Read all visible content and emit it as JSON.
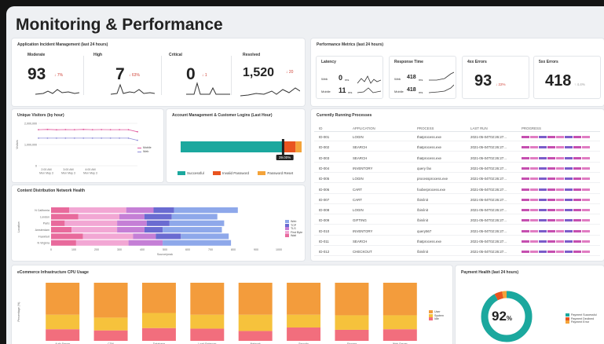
{
  "page_title": "Monitoring & Performance",
  "incident": {
    "title": "Application Incident Management (last 24 hours)",
    "tiles": [
      {
        "label": "Moderate",
        "value": "93",
        "delta": "↓ 7%"
      },
      {
        "label": "High",
        "value": "7",
        "delta": "↓ 63%"
      },
      {
        "label": "Critical",
        "value": "0",
        "delta": "↓ 1"
      },
      {
        "label": "Resolved",
        "value": "1,520",
        "delta": "↓ 20"
      }
    ]
  },
  "perf": {
    "title": "Performance Metrics (last 24 hours)",
    "latency": {
      "label": "Latency",
      "web_label": "Web",
      "web_value": "0",
      "web_unit": "ms",
      "mobile_label": "Mobile",
      "mobile_value": "11",
      "mobile_unit": "ms"
    },
    "response": {
      "label": "Response Time",
      "web_label": "Web",
      "web_value": "418",
      "web_unit": "ms",
      "mobile_label": "Mobile",
      "mobile_value": "418",
      "mobile_unit": "ms"
    },
    "errors4xx": {
      "label": "4xx Errors",
      "value": "93",
      "delta": "↓ 22%"
    },
    "errors5xx": {
      "label": "5xx Errors",
      "value": "418",
      "delta": "↑ 4.4%"
    }
  },
  "visitors": {
    "title": "Unique Visitors (by hour)",
    "ylabel": "Visitors",
    "yticks": [
      "2,000,000",
      "1,000,000",
      "0"
    ],
    "xticks": [
      "2:00 AM\nMon May 3",
      "3:00 AM\nMon May 3",
      "4:00 AM\nMon May 3"
    ],
    "legend": [
      "Mobile",
      "Web"
    ]
  },
  "logins": {
    "title": "Account Management & Customer Logins (Last Hour)",
    "marker": "39.00%",
    "legend": [
      "Successful",
      "Invalid Password",
      "Password Reset"
    ],
    "colors": [
      "#1ba89e",
      "#e9541f",
      "#f4a339"
    ]
  },
  "processes": {
    "title": "Currently Running Processes",
    "columns": [
      "ID",
      "APPLICATION",
      "PROCESS",
      "LAST RUN",
      "PROGRESS"
    ],
    "rows": [
      [
        "ID-001",
        "LOGIN",
        "thatprocess.exe",
        "2021-05-04T02:26:27..."
      ],
      [
        "ID-002",
        "SEARCH",
        "thatprocess.exe",
        "2021-05-04T02:26:27..."
      ],
      [
        "ID-003",
        "SEARCH",
        "thatprocess.exe",
        "2021-05-04T02:26:27..."
      ],
      [
        "ID-004",
        "INVENTORY",
        "query fax",
        "2021-05-04T02:26:27..."
      ],
      [
        "ID-005",
        "LOGIN",
        "processprocess.exe",
        "2021-05-04T02:26:27..."
      ],
      [
        "ID-006",
        "CART",
        "fooberprocess.exe",
        "2021-05-04T02:26:27..."
      ],
      [
        "ID-007",
        "CART",
        "/bin/init",
        "2021-05-04T02:26:27..."
      ],
      [
        "ID-008",
        "LOGIN",
        "/bin/init",
        "2021-05-04T02:26:27..."
      ],
      [
        "ID-009",
        "GIFTING",
        "/bin/init",
        "2021-05-04T02:26:27..."
      ],
      [
        "ID-010",
        "INVENTORY",
        "query567",
        "2021-05-04T02:26:27..."
      ],
      [
        "ID-011",
        "SEARCH",
        "thatprocess.exe",
        "2021-05-04T02:26:27..."
      ],
      [
        "ID-012",
        "CHECKOUT",
        "/bin/init",
        "2021-05-04T02:26:27..."
      ]
    ]
  },
  "cdn": {
    "title": "Content Distribution Network Health",
    "xlabel": "Source/peak",
    "ylabel": "Location",
    "locations": [
      "N California",
      "London",
      "Paris",
      "Amsterdam",
      "Frankfurt",
      "N Virginia"
    ],
    "xticks": [
      "0",
      "100",
      "200",
      "300",
      "400",
      "500",
      "600",
      "700",
      "800",
      "900",
      "1000"
    ],
    "legend": [
      "Web",
      "TCP",
      "TLS",
      "First Byte",
      "Wait"
    ]
  },
  "cpu": {
    "title": "eCommerce Infrastructure CPU Usage",
    "ylabel": "Percentage (%)",
    "xlabel": "Dev",
    "legend": [
      "User",
      "System",
      "Idle"
    ]
  },
  "payment": {
    "title": "Payment Health (last 24 hours)",
    "value": "92",
    "unit": "%",
    "legend": [
      "Payment Successful",
      "Payment Declined",
      "Payment Error"
    ]
  },
  "chart_data": [
    {
      "type": "line",
      "title": "Unique Visitors (by hour)",
      "ylabel": "Visitors",
      "ylim": [
        0,
        2000000
      ],
      "series": [
        {
          "name": "Mobile",
          "color": "#e0579c",
          "values": [
            1700000,
            1710000,
            1695000,
            1705000,
            1700000,
            1710000,
            1700000,
            1705000,
            1700000,
            1700000,
            1700000,
            1600000
          ]
        },
        {
          "name": "Web",
          "color": "#8e8cd8",
          "values": [
            1300000,
            1300000,
            1300000,
            1300000,
            1300000,
            1300000,
            1300000,
            1300000,
            1300000,
            1300000,
            1300000,
            1200000
          ]
        }
      ]
    },
    {
      "type": "bar",
      "title": "Account Management & Customer Logins (Last Hour)",
      "categories": [
        "Successful",
        "Invalid Password",
        "Password Reset"
      ],
      "values": [
        85,
        10,
        5
      ]
    },
    {
      "type": "bar",
      "title": "Content Distribution Network Health",
      "xlabel": "Source/peak",
      "ylabel": "Location",
      "categories": [
        "N California",
        "London",
        "Paris",
        "Amsterdam",
        "Frankfurt",
        "N Virginia"
      ],
      "xlim": [
        0,
        1000
      ],
      "series": [
        {
          "name": "Wait",
          "color": "#e86a9c",
          "values": [
            80,
            120,
            60,
            90,
            140,
            110
          ]
        },
        {
          "name": "First Byte",
          "color": "#f2a7d4",
          "values": [
            250,
            180,
            230,
            200,
            220,
            230
          ]
        },
        {
          "name": "TLS",
          "color": "#c57fd6",
          "values": [
            120,
            110,
            130,
            120,
            100,
            150
          ]
        },
        {
          "name": "TCP",
          "color": "#6a6bd1",
          "values": [
            90,
            120,
            100,
            80,
            110,
            0
          ]
        },
        {
          "name": "Web",
          "color": "#8ea8ea",
          "values": [
            280,
            200,
            240,
            260,
            210,
            300
          ]
        }
      ]
    },
    {
      "type": "bar",
      "title": "eCommerce Infrastructure CPU Usage",
      "ylabel": "Percentage (%)",
      "xlabel": "Dev",
      "categories": [
        "Auth Server",
        "CDN",
        "Database",
        "Load Balancer",
        "Network",
        "Security",
        "Storage",
        "Web Server"
      ],
      "ylim": [
        0,
        100
      ],
      "series": [
        {
          "name": "Idle",
          "color": "#f26e7d",
          "values": [
            20,
            18,
            22,
            21,
            17,
            23,
            19,
            20
          ]
        },
        {
          "name": "System",
          "color": "#f6c23c",
          "values": [
            25,
            22,
            26,
            24,
            28,
            22,
            25,
            24
          ]
        },
        {
          "name": "User",
          "color": "#f39c3c",
          "values": [
            55,
            60,
            52,
            55,
            55,
            55,
            56,
            56
          ]
        }
      ]
    },
    {
      "type": "pie",
      "title": "Payment Health (last 24 hours)",
      "categories": [
        "Payment Successful",
        "Payment Declined",
        "Payment Error"
      ],
      "values": [
        92,
        5,
        3
      ],
      "colors": [
        "#1ba89e",
        "#e9541f",
        "#f4a339"
      ]
    }
  ]
}
